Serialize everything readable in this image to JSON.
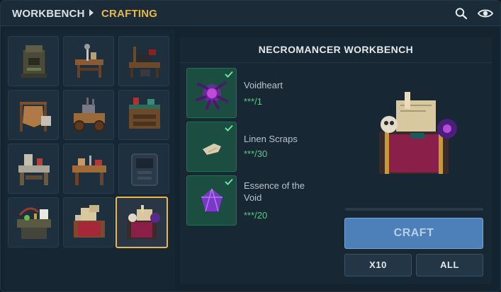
{
  "header": {
    "breadcrumb_root": "WORKBENCH",
    "breadcrumb_current": "CRAFTING",
    "icons": [
      "search-icon",
      "eye-icon"
    ]
  },
  "workbench_grid": {
    "selected_index": 11,
    "items": [
      {
        "icon": "furnace-bench-icon"
      },
      {
        "icon": "tool-bench-icon"
      },
      {
        "icon": "anvil-bench-icon"
      },
      {
        "icon": "tanning-rack-icon"
      },
      {
        "icon": "alchemy-cart-icon"
      },
      {
        "icon": "cooking-station-icon"
      },
      {
        "icon": "stone-bench-icon"
      },
      {
        "icon": "carpentry-bench-icon"
      },
      {
        "icon": "locked-machine-icon"
      },
      {
        "icon": "potion-bench-icon"
      },
      {
        "icon": "scroll-bench-icon"
      },
      {
        "icon": "necromancer-bench-icon"
      }
    ]
  },
  "recipe": {
    "title": "NECROMANCER WORKBENCH",
    "ingredients": [
      {
        "name": "Voidheart",
        "qty": "***/1",
        "icon": "voidheart-icon",
        "fulfilled": true
      },
      {
        "name": "Linen Scraps",
        "qty": "***/30",
        "icon": "linen-scraps-icon",
        "fulfilled": true
      },
      {
        "name": "Essence of the Void",
        "qty": "***/20",
        "icon": "void-essence-icon",
        "fulfilled": true
      }
    ],
    "preview_icon": "necromancer-workbench-icon",
    "progress": 0.0
  },
  "actions": {
    "craft_label": "CRAFT",
    "x10_label": "X10",
    "all_label": "ALL"
  },
  "colors": {
    "accent_gold": "#e6b84a",
    "ok_green": "#5fc88a",
    "craft_blue": "#4d7fb8"
  }
}
